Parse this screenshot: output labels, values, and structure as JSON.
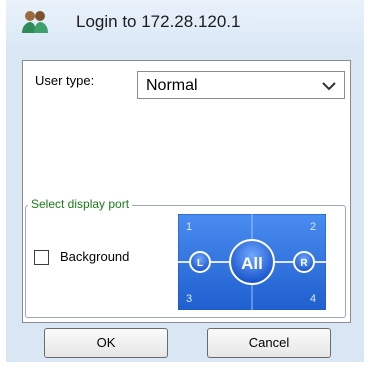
{
  "window": {
    "title": "Login to 172.28.120.1",
    "icon": "users-icon"
  },
  "form": {
    "user_type_label": "User type:",
    "user_type_value": "Normal",
    "user_type_arrow_icon": "chevron-down-icon"
  },
  "display_port": {
    "group_title": "Select display port",
    "background_label": "Background",
    "background_checked": false,
    "port_numbers": [
      "1",
      "2",
      "3",
      "4"
    ],
    "left_button": "L",
    "all_button": "All",
    "right_button": "R",
    "colors": {
      "panel": "#2b6fd6",
      "button": "#1f64d8",
      "line": "#ffffff"
    }
  },
  "buttons": {
    "ok": "OK",
    "cancel": "Cancel"
  }
}
